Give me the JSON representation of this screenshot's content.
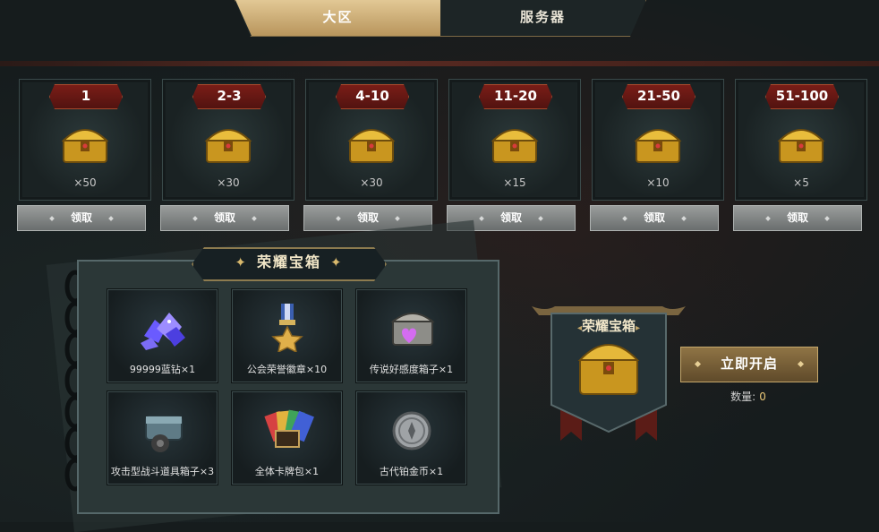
{
  "tabs": [
    {
      "label": "大区",
      "active": true
    },
    {
      "label": "服务器",
      "active": false
    }
  ],
  "rank_rewards": [
    {
      "rank": "1",
      "count": "×50",
      "button": "领取"
    },
    {
      "rank": "2-3",
      "count": "×30",
      "button": "领取"
    },
    {
      "rank": "4-10",
      "count": "×30",
      "button": "领取"
    },
    {
      "rank": "11-20",
      "count": "×15",
      "button": "领取"
    },
    {
      "rank": "21-50",
      "count": "×10",
      "button": "领取"
    },
    {
      "rank": "51-100",
      "count": "×5",
      "button": "领取"
    }
  ],
  "glory_box": {
    "title": "荣耀宝箱",
    "spark_icon": "✦",
    "items": [
      {
        "label": "99999蓝钻×1",
        "icon": "blue-diamond-icon"
      },
      {
        "label": "公会荣誉徽章×10",
        "icon": "medal-icon"
      },
      {
        "label": "传说好感度箱子×1",
        "icon": "heart-chest-icon"
      },
      {
        "label": "攻击型战斗道具箱子×3",
        "icon": "battle-item-chest-icon"
      },
      {
        "label": "全体卡牌包×1",
        "icon": "card-pack-icon"
      },
      {
        "label": "古代铂金币×1",
        "icon": "platinum-coin-icon"
      }
    ]
  },
  "banner": {
    "title": "荣耀宝箱",
    "open_button": "立即开启",
    "quantity_label": "数量:",
    "quantity_value": "0"
  },
  "colors": {
    "gold": "#c6a86b",
    "rank_red": "#7a1d17",
    "background": "#161c1d"
  }
}
